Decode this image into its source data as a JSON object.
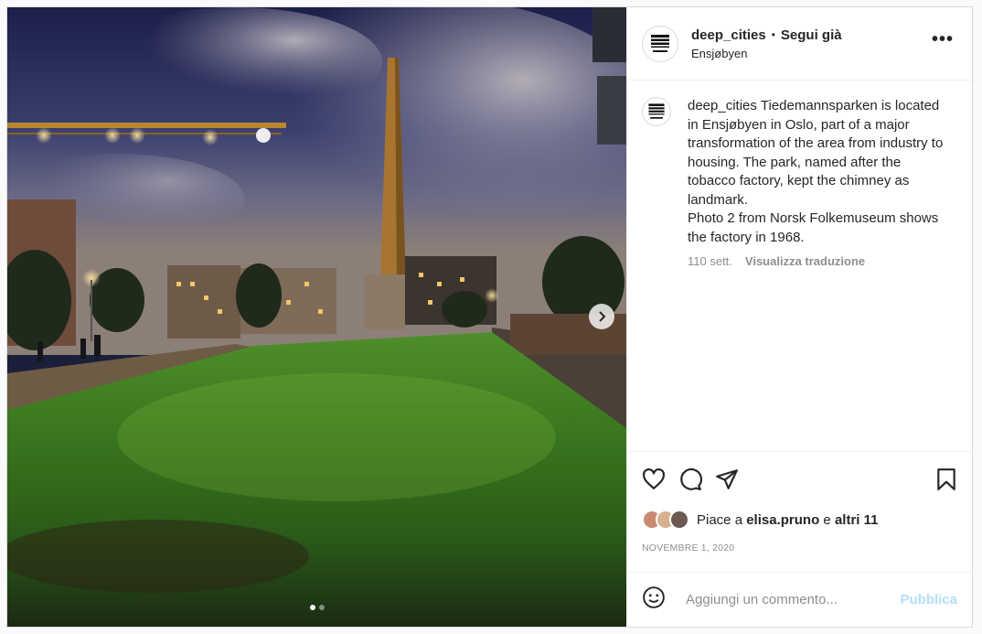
{
  "post": {
    "username": "deep_cities",
    "follow_label": "Segui già",
    "location": "Ensjøbyen",
    "more_label": "•••",
    "caption": "Tiedemannsparken is located in Ensjøbyen in Oslo, part of a major transformation of the area from industry to housing. The park, named after the tobacco factory, kept the chimney as landmark.\nPhoto 2 from Norsk Folkemuseum shows the factory in 1968.",
    "age": "110 sett.",
    "translate_label": "Visualizza traduzione",
    "likes_prefix": "Piace a",
    "likes_user": "elisa.pruno",
    "likes_conj": "e",
    "likes_others": "altri 11",
    "date": "NOVEMBRE 1, 2020",
    "comment_placeholder": "Aggiungi un commento...",
    "publish_label": "Pubblica"
  },
  "carousel": {
    "current": 1,
    "total": 2
  },
  "icons": {
    "like": "heart-icon",
    "comment": "comment-bubble-icon",
    "share": "paper-plane-icon",
    "save": "bookmark-icon",
    "emoji": "smiley-icon",
    "next": "chevron-right-icon"
  },
  "colors": {
    "publish_disabled": "#b2dffc",
    "muted": "#8e8e8e",
    "text": "#262626"
  }
}
